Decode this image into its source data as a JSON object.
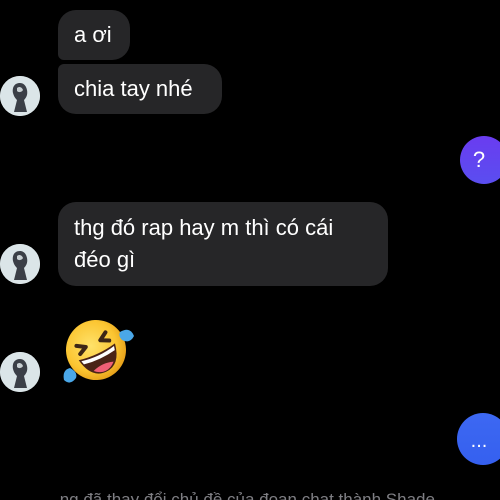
{
  "conversation": {
    "messages": [
      {
        "sender": "contact",
        "type": "text",
        "text": "a ơi"
      },
      {
        "sender": "contact",
        "type": "text",
        "text": "chia tay nhé"
      },
      {
        "sender": "me",
        "type": "text",
        "text": "?"
      },
      {
        "sender": "contact",
        "type": "text",
        "text": "thg đó rap hay m thì có cái đéo gì"
      },
      {
        "sender": "contact",
        "type": "emoji",
        "icon": "rolling-on-floor-laughing-emoji"
      },
      {
        "sender": "me",
        "type": "text",
        "text": "..."
      }
    ],
    "system_text": "… ng đã thay đổi chủ đề của đoạn chat thành Shade"
  },
  "colors": {
    "background": "#000000",
    "incoming_bubble": "#262628",
    "outgoing_bubble_top": "#6a3cf0",
    "outgoing_bubble_bottom": "#3b63f2",
    "text": "#ffffff",
    "system_text": "#7e7e83"
  }
}
